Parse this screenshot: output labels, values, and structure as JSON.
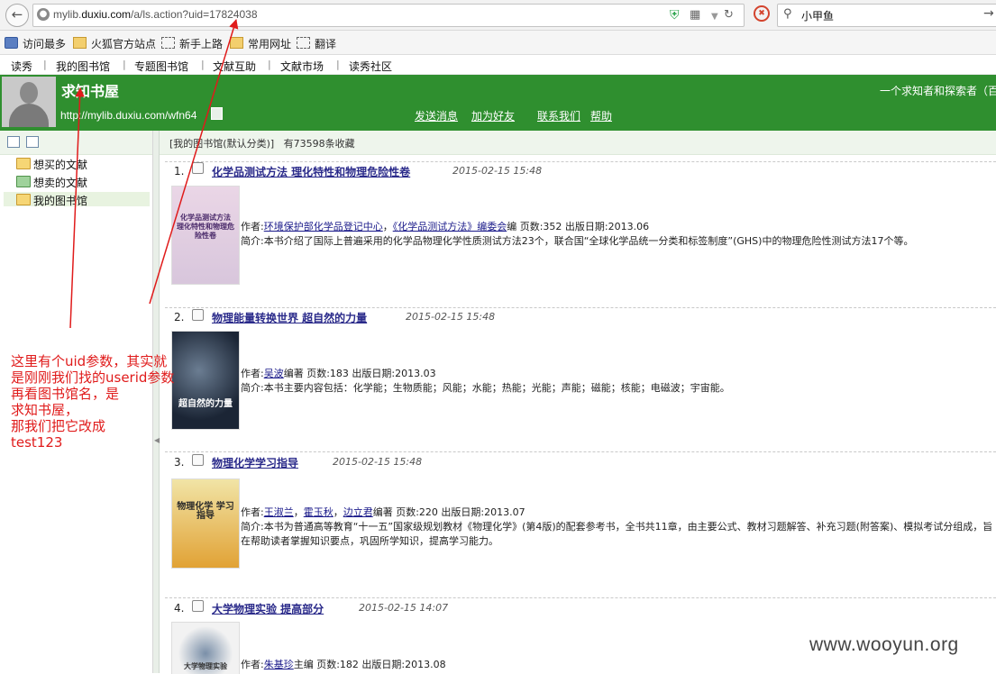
{
  "browser": {
    "url_prefix": "mylib.",
    "url_domain": "duxiu.com",
    "url_path": "/a/ls.action?uid=17824038",
    "search_text": "小甲鱼"
  },
  "bookmarks": [
    {
      "label": "访问最多",
      "icon": "blue-bookmark-icon"
    },
    {
      "label": "火狐官方站点",
      "icon": "folder-icon"
    },
    {
      "label": "新手上路",
      "icon": "dashed-box-icon"
    },
    {
      "label": "常用网址",
      "icon": "folder-icon"
    },
    {
      "label": "翻译",
      "icon": "dashed-box-icon"
    }
  ],
  "site_nav": [
    "读秀",
    "我的图书馆",
    "专题图书馆",
    "文献互助",
    "文献市场",
    "读秀社区"
  ],
  "header": {
    "library_name": "求知书屋",
    "library_url": "http://mylib.duxiu.com/wfn64",
    "links": [
      "发送消息",
      "加为好友",
      "联系我们",
      "帮助"
    ],
    "slogan": "一个求知者和探索者（百"
  },
  "sidebar": {
    "items": [
      "想买的文献",
      "想卖的文献",
      "我的图书馆"
    ]
  },
  "main": {
    "crumb": "[我的图书馆(默认分类)]",
    "count_text": "有73598条收藏",
    "books": [
      {
        "num": "1.",
        "title": "化学品测试方法 理化特性和物理危险性卷",
        "date": "2015-02-15 15:48",
        "cover_title": "化学品测试方法 理化特性和物理危险性卷",
        "author_prefix": "作者:",
        "authors": [
          "环境保护部化学品登记中心",
          "《化学品测试方法》编委会"
        ],
        "author_suffix": "编 页数:352 出版日期:2013.06",
        "intro": "简介:本书介绍了国际上普遍采用的化学品物理化学性质测试方法23个，联合国“全球化学品统一分类和标签制度”(GHS)中的物理危险性测试方法17个等。"
      },
      {
        "num": "2.",
        "title": "物理能量转换世界 超自然的力量",
        "date": "2015-02-15 15:48",
        "cover_title": "超自然的力量",
        "author_prefix": "作者:",
        "authors": [
          "吴波"
        ],
        "author_suffix": "编著 页数:183 出版日期:2013.03",
        "intro": "简介:本书主要内容包括：化学能；生物质能；风能；水能；热能；光能；声能；磁能；核能；电磁波；宇宙能。"
      },
      {
        "num": "3.",
        "title": "物理化学学习指导",
        "date": "2015-02-15 15:48",
        "cover_title": "物理化学 学习指导",
        "author_prefix": "作者:",
        "authors": [
          "王淑兰",
          "霍玉秋",
          "边立君"
        ],
        "author_suffix": "编著 页数:220 出版日期:2013.07",
        "intro": "简介:本书为普通高等教育“十一五”国家级规划教材《物理化学》(第4版)的配套参考书，全书共11章，由主要公式、教材习题解答、补充习题(附答案)、模拟考试分组成，旨在帮助读者掌握知识要点，巩固所学知识，提高学习能力。"
      },
      {
        "num": "4.",
        "title": "大学物理实验 提高部分",
        "date": "2015-02-15 14:07",
        "cover_title": "大学物理实验",
        "author_prefix": "作者:",
        "authors": [
          "朱基珍"
        ],
        "author_suffix": "主编 页数:182 出版日期:2013.08",
        "intro": ""
      }
    ]
  },
  "annotation": {
    "lines": [
      "这里有个uid参数，其实就",
      "是刚刚我们找的userid参数",
      "再看图书馆名，是",
      "求知书屋，",
      "那我们把它改成",
      "test123"
    ]
  },
  "watermark": "www.wooyun.org",
  "colors": {
    "header_green": "#2f8f2f",
    "annotation_red": "#e01b1b",
    "title_blue": "#2a2a8a"
  }
}
